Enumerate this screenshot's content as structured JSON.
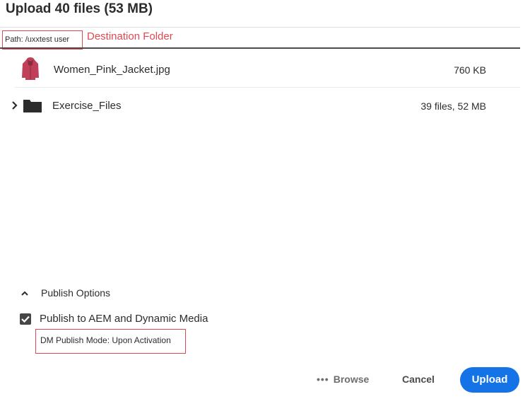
{
  "dialog": {
    "title": "Upload 40 files (53 MB)",
    "path_label": "Path: /uxxtest user",
    "destination_annotation": "Destination Folder"
  },
  "files": [
    {
      "name": "Women_Pink_Jacket.jpg",
      "size": "760 KB",
      "icon": "jacket-thumbnail"
    },
    {
      "name": "Exercise_Files",
      "size": "39 files, 52 MB",
      "icon": "folder-icon"
    }
  ],
  "publish": {
    "section_label": "Publish Options",
    "checkbox_label": "Publish to AEM and Dynamic Media",
    "checked": true,
    "mode_text": "DM Publish Mode:  Upon Activation"
  },
  "footer": {
    "browse_label": "Browse",
    "cancel_label": "Cancel",
    "upload_label": "Upload"
  },
  "colors": {
    "annotation": "#e34850",
    "primary": "#1473e6"
  }
}
